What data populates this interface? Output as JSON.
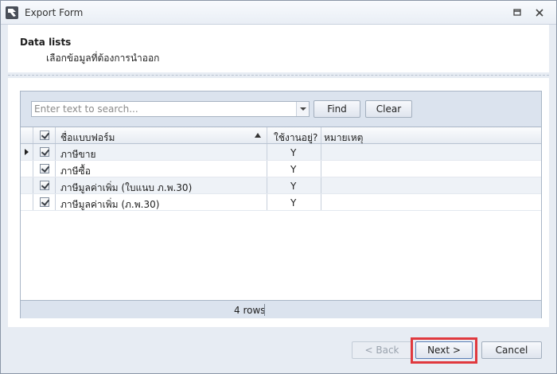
{
  "window": {
    "title": "Export Form"
  },
  "header": {
    "title": "Data lists",
    "subtitle": "เลือกข้อมูลที่ต้องการนำออก"
  },
  "search": {
    "placeholder": "Enter text to search...",
    "value": ""
  },
  "toolbar": {
    "find_label": "Find",
    "clear_label": "Clear"
  },
  "grid": {
    "columns": [
      "ชื่อแบบฟอร์ม",
      "ใช้งานอยู่?",
      "หมายเหตุ"
    ],
    "sort_column": "ชื่อแบบฟอร์ม",
    "rows": [
      {
        "checked": true,
        "name": "ภาษีขาย",
        "active": "Y",
        "note": ""
      },
      {
        "checked": true,
        "name": "ภาษีซื้อ",
        "active": "Y",
        "note": ""
      },
      {
        "checked": true,
        "name": "ภาษีมูลค่าเพิ่ม (ใบแนบ ภ.พ.30)",
        "active": "Y",
        "note": ""
      },
      {
        "checked": true,
        "name": "ภาษีมูลค่าเพิ่ม (ภ.พ.30)",
        "active": "Y",
        "note": ""
      }
    ],
    "row_count": "4 rows"
  },
  "buttons": {
    "back": "< Back",
    "next": "Next >",
    "cancel": "Cancel"
  },
  "colors": {
    "highlight": "#e0393e",
    "alt_row": "#eef2f7",
    "panel": "#dbe3ee"
  }
}
